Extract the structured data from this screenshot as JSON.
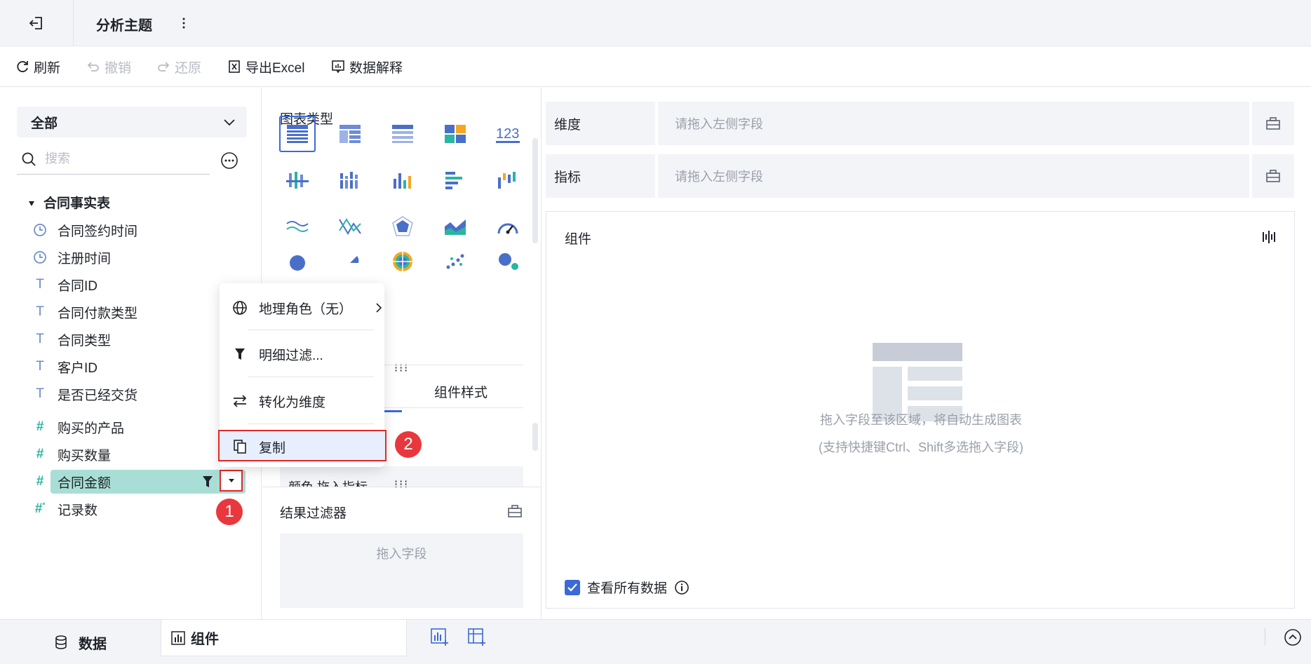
{
  "header": {
    "title": "分析主题",
    "back_icon": "exit-icon",
    "more_icon": "more-vertical-icon"
  },
  "toolbar": {
    "refresh": "刷新",
    "undo": "撤销",
    "redo": "还原",
    "export_excel": "导出Excel",
    "data_explain": "数据解释"
  },
  "left_panel": {
    "scope_select": "全部",
    "search_placeholder": "搜索",
    "table_name": "合同事实表",
    "fields": [
      {
        "label": "合同签约时间",
        "type": "time"
      },
      {
        "label": "注册时间",
        "type": "time"
      },
      {
        "label": "合同ID",
        "type": "text"
      },
      {
        "label": "合同付款类型",
        "type": "text"
      },
      {
        "label": "合同类型",
        "type": "text"
      },
      {
        "label": "客户ID",
        "type": "text"
      },
      {
        "label": "是否已经交货",
        "type": "text"
      },
      {
        "label": "购买的产品",
        "type": "number"
      },
      {
        "label": "购买数量",
        "type": "number"
      },
      {
        "label": "合同金额",
        "type": "number",
        "selected": true
      },
      {
        "label": "记录数",
        "type": "number-calc"
      }
    ]
  },
  "context_menu": {
    "items": [
      {
        "label": "地理角色（无）",
        "icon": "globe-icon"
      },
      {
        "label": "明细过滤...",
        "icon": "filter-icon"
      },
      {
        "label": "转化为维度",
        "icon": "swap-icon"
      },
      {
        "label": "复制",
        "icon": "copy-icon"
      }
    ]
  },
  "steps": {
    "one": "1",
    "two": "2"
  },
  "middle_panel": {
    "chart_type_title": "图表类型",
    "tab_style": "组件样式",
    "color_row_text": "颜色   拖入指标",
    "result_filter_title": "结果过滤器",
    "result_filter_placeholder": "拖入字段"
  },
  "right_panel": {
    "dimension_label": "维度",
    "dimension_placeholder": "请拖入左侧字段",
    "measure_label": "指标",
    "measure_placeholder": "请拖入左侧字段",
    "component_title": "组件",
    "empty_hint": "拖入字段至该区域，将自动生成图表",
    "empty_hint_sub": "(支持快捷键Ctrl、Shift多选拖入字段)",
    "view_all_data": "查看所有数据",
    "view_all_checked": true
  },
  "bottom_bar": {
    "data_tab": "数据",
    "component_tab": "组件"
  },
  "colors": {
    "accent": "#3b6ad6",
    "measure": "#2ab5a2",
    "selected_field_bg": "#a9ded6",
    "annotation_red": "#e8383d"
  }
}
